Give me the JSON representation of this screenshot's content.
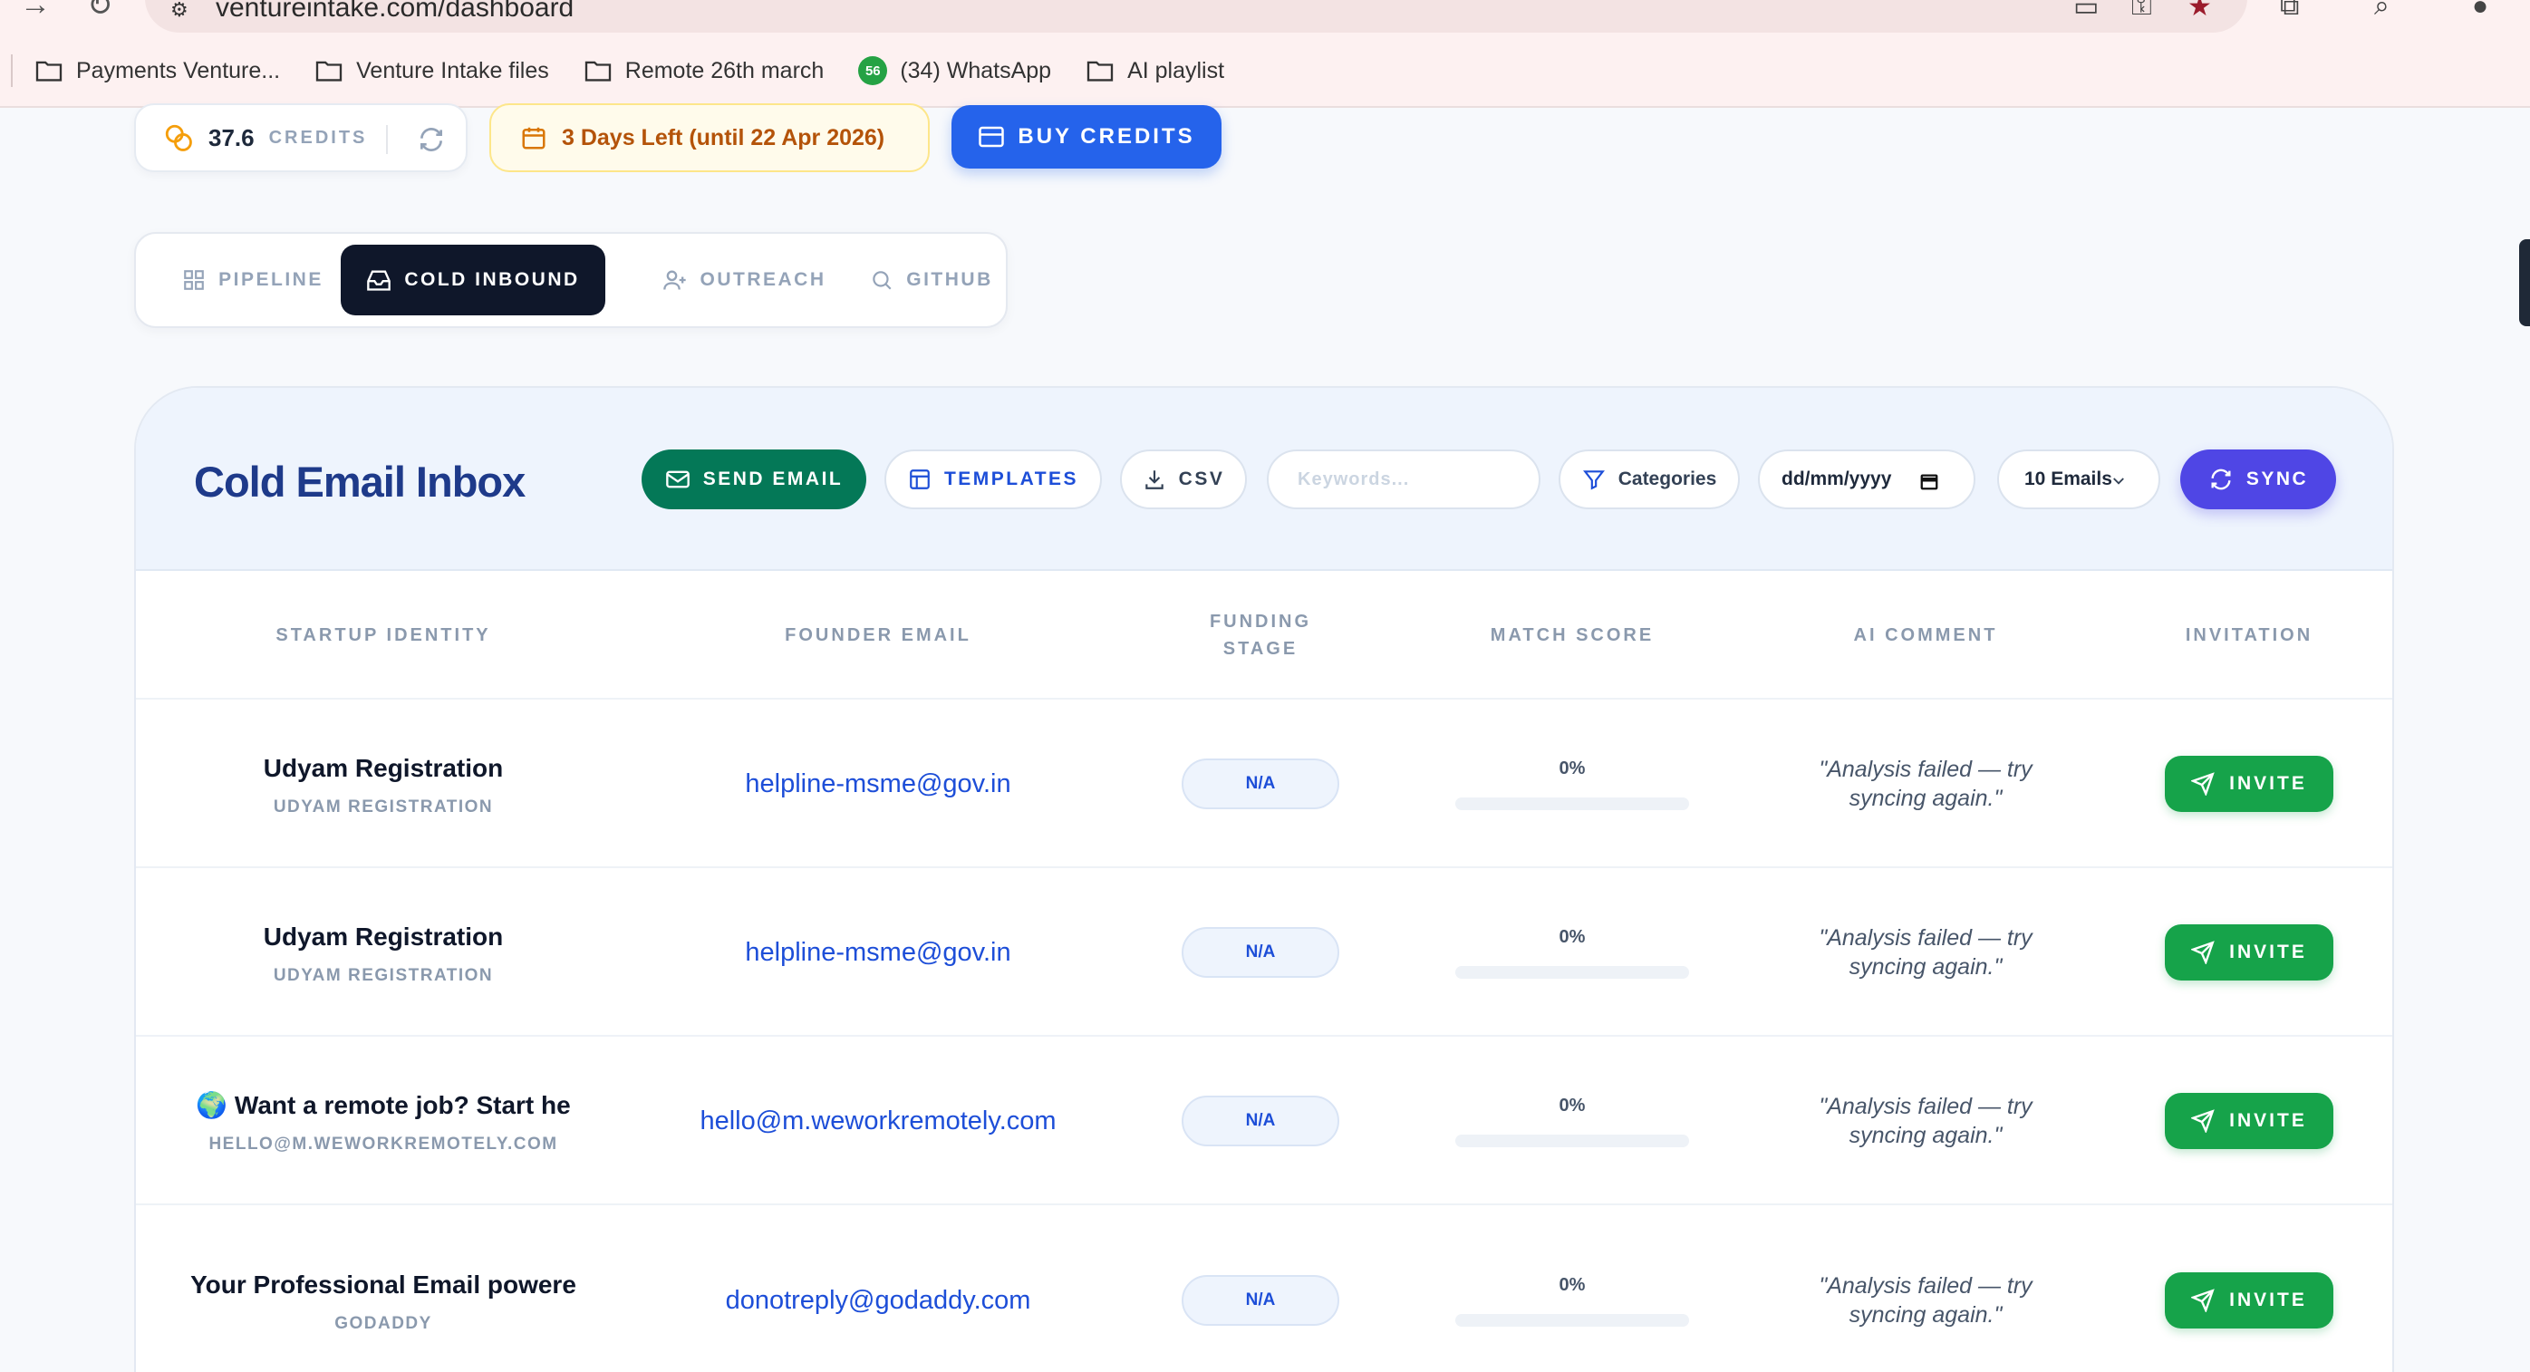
{
  "browser": {
    "url": "ventureintake.com/dashboard",
    "bookmarks": [
      {
        "label": "Payments Venture..."
      },
      {
        "label": "Venture Intake files"
      },
      {
        "label": "Remote 26th march"
      },
      {
        "label": "(34) WhatsApp",
        "badge": "56"
      },
      {
        "label": "AI playlist"
      }
    ]
  },
  "credits": {
    "value": "37.6",
    "label": "CREDITS"
  },
  "trial": {
    "text": "3 Days Left (until 22 Apr 2026)"
  },
  "buy": {
    "label": "BUY CREDITS"
  },
  "tabs": [
    {
      "label": "PIPELINE",
      "active": false
    },
    {
      "label": "COLD INBOUND",
      "active": true
    },
    {
      "label": "OUTREACH",
      "active": false
    },
    {
      "label": "GITHUB",
      "active": false
    }
  ],
  "inbox": {
    "title": "Cold Email Inbox",
    "send_label": "SEND EMAIL",
    "templates_label": "TEMPLATES",
    "csv_label": "CSV",
    "keywords_placeholder": "Keywords...",
    "categories_label": "Categories",
    "date_placeholder": "dd/mm/yyyy",
    "emails_selected": "10 Emails",
    "sync_label": "SYNC"
  },
  "table": {
    "headers": {
      "identity": "STARTUP IDENTITY",
      "email": "FOUNDER EMAIL",
      "stage_1": "FUNDING",
      "stage_2": "STAGE",
      "score": "MATCH SCORE",
      "comment": "AI COMMENT",
      "invitation": "INVITATION"
    },
    "rows": [
      {
        "name": "Udyam Registration",
        "sub": "UDYAM REGISTRATION",
        "email": "helpline-msme@gov.in",
        "stage": "N/A",
        "score": "0%",
        "score_value": 0,
        "comment": "\"Analysis failed — try syncing again.\"",
        "invite": "INVITE"
      },
      {
        "name": "Udyam Registration",
        "sub": "UDYAM REGISTRATION",
        "email": "helpline-msme@gov.in",
        "stage": "N/A",
        "score": "0%",
        "score_value": 0,
        "comment": "\"Analysis failed — try syncing again.\"",
        "invite": "INVITE"
      },
      {
        "name": "🌍 Want a remote job? Start he",
        "sub": "HELLO@M.WEWORKREMOTELY.COM",
        "email": "hello@m.weworkremotely.com",
        "stage": "N/A",
        "score": "0%",
        "score_value": 0,
        "comment": "\"Analysis failed — try syncing again.\"",
        "invite": "INVITE"
      },
      {
        "name": "Your Professional Email powere",
        "sub": "GODADDY",
        "email": "donotreply@godaddy.com",
        "stage": "N/A",
        "score": "0%",
        "score_value": 0,
        "comment": "\"Analysis failed — try syncing again.\"",
        "invite": "INVITE"
      }
    ]
  },
  "colors": {
    "accent": "#2563eb",
    "send": "#047857",
    "sync": "#4f46e5",
    "invite": "#16a34a",
    "title": "#1e3a8a"
  }
}
